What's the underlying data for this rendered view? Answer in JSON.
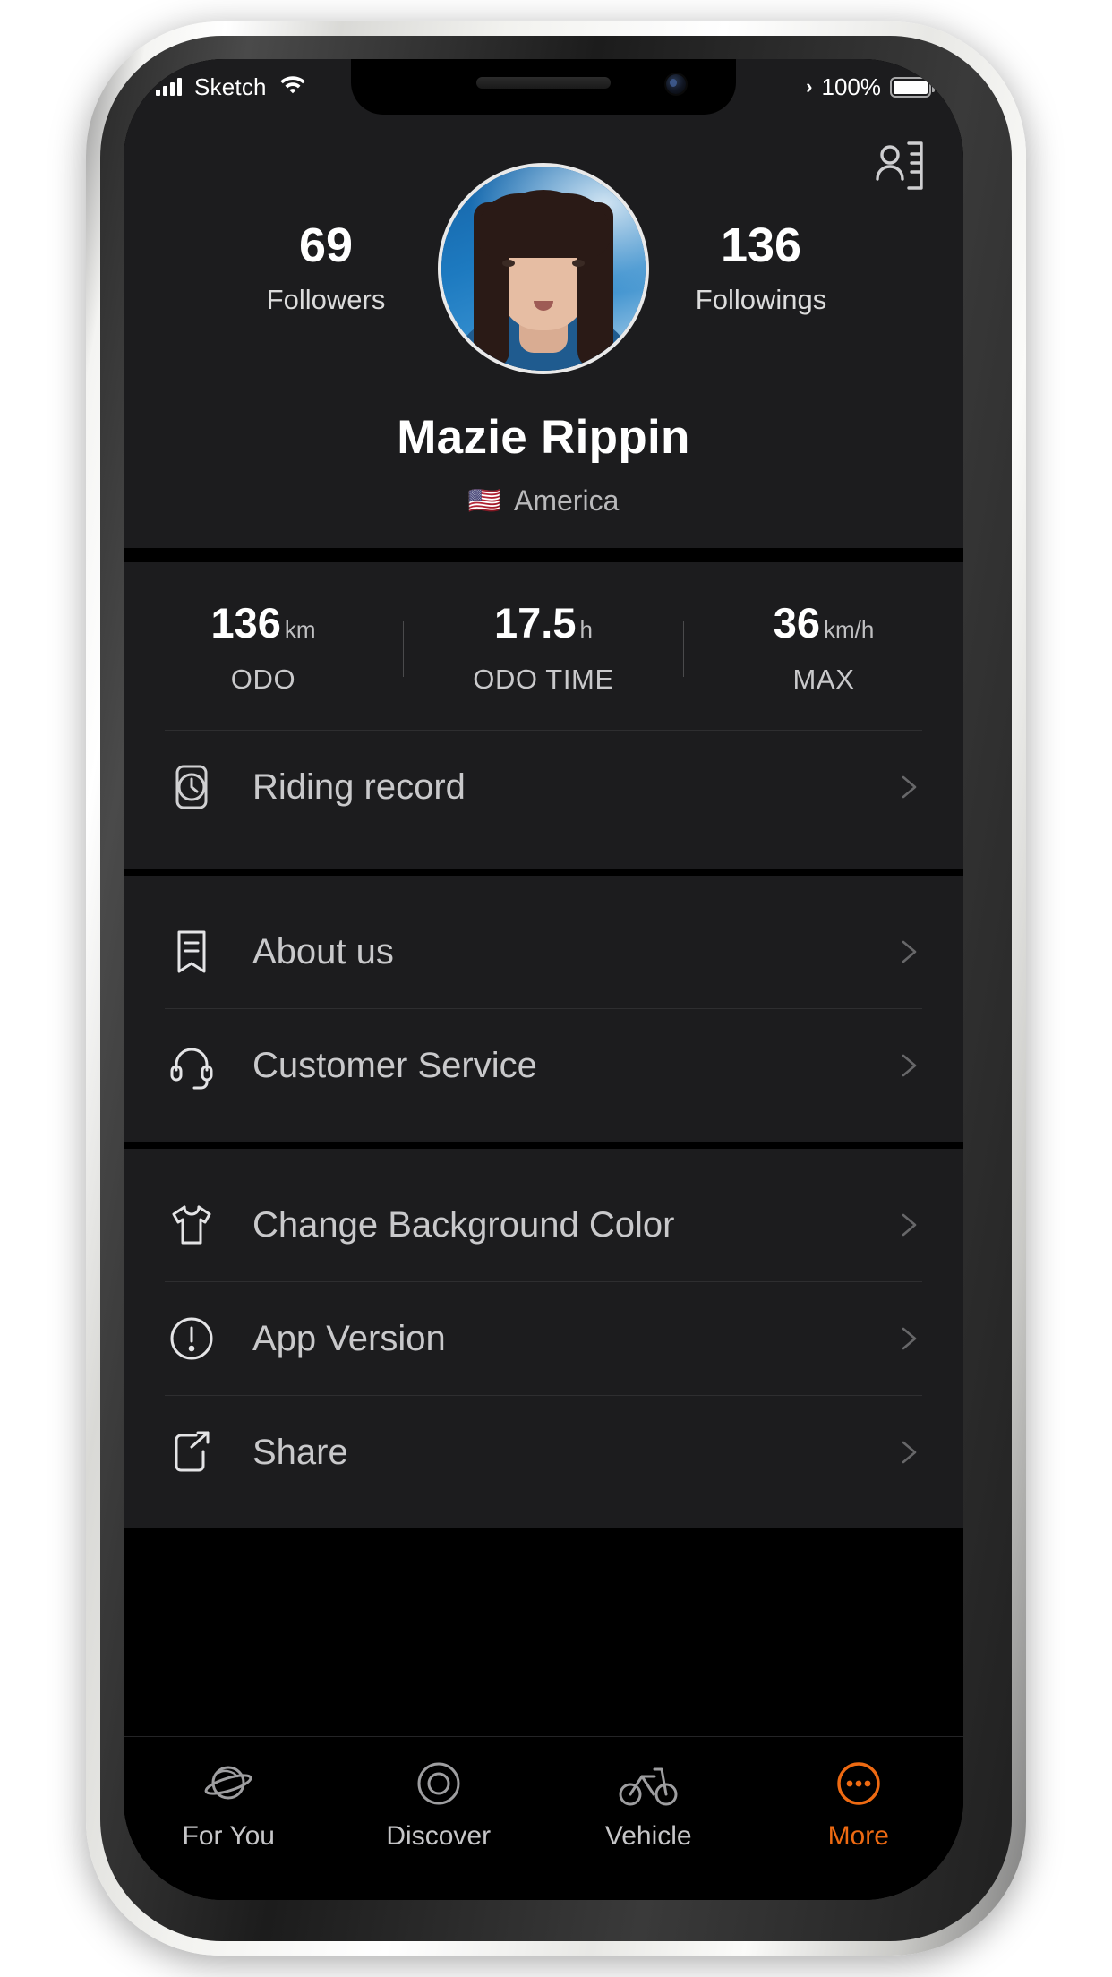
{
  "status_bar": {
    "signal_icon": "cellular-bars-icon",
    "carrier": "Sketch",
    "wifi_icon": "wifi-icon",
    "location_chevron": "›",
    "battery_percent": "100%",
    "battery_icon": "battery-full-icon"
  },
  "header": {
    "contact_icon": "contact-card-icon",
    "avatar_name": "avatar",
    "followers": {
      "count": "69",
      "label": "Followers"
    },
    "followings": {
      "count": "136",
      "label": "Followings"
    },
    "username": "Mazie Rippin",
    "country_flag": "🇺🇸",
    "country": "America"
  },
  "stats": [
    {
      "value": "136",
      "unit": "km",
      "title": "ODO"
    },
    {
      "value": "17.5",
      "unit": "h",
      "title": "ODO TIME"
    },
    {
      "value": "36",
      "unit": "km/h",
      "title": "MAX"
    }
  ],
  "menu_group_1": [
    {
      "icon": "clock-record-icon",
      "label": "Riding record"
    }
  ],
  "menu_group_2": [
    {
      "icon": "bookmark-document-icon",
      "label": "About us"
    },
    {
      "icon": "headset-icon",
      "label": "Customer Service"
    }
  ],
  "menu_group_3": [
    {
      "icon": "tshirt-icon",
      "label": "Change Background Color"
    },
    {
      "icon": "exclamation-circle-icon",
      "label": "App Version"
    },
    {
      "icon": "share-export-icon",
      "label": "Share"
    }
  ],
  "tabs": [
    {
      "icon": "planet-icon",
      "label": "For You",
      "active": false
    },
    {
      "icon": "target-circles-icon",
      "label": "Discover",
      "active": false
    },
    {
      "icon": "bicycle-icon",
      "label": "Vehicle",
      "active": false
    },
    {
      "icon": "more-dots-circle-icon",
      "label": "More",
      "active": true
    }
  ],
  "colors": {
    "accent": "#ee6a12",
    "card_bg": "#1c1c1e",
    "screen_bg": "#000000",
    "text_primary": "#ffffff",
    "text_secondary": "#c9c9cb"
  }
}
